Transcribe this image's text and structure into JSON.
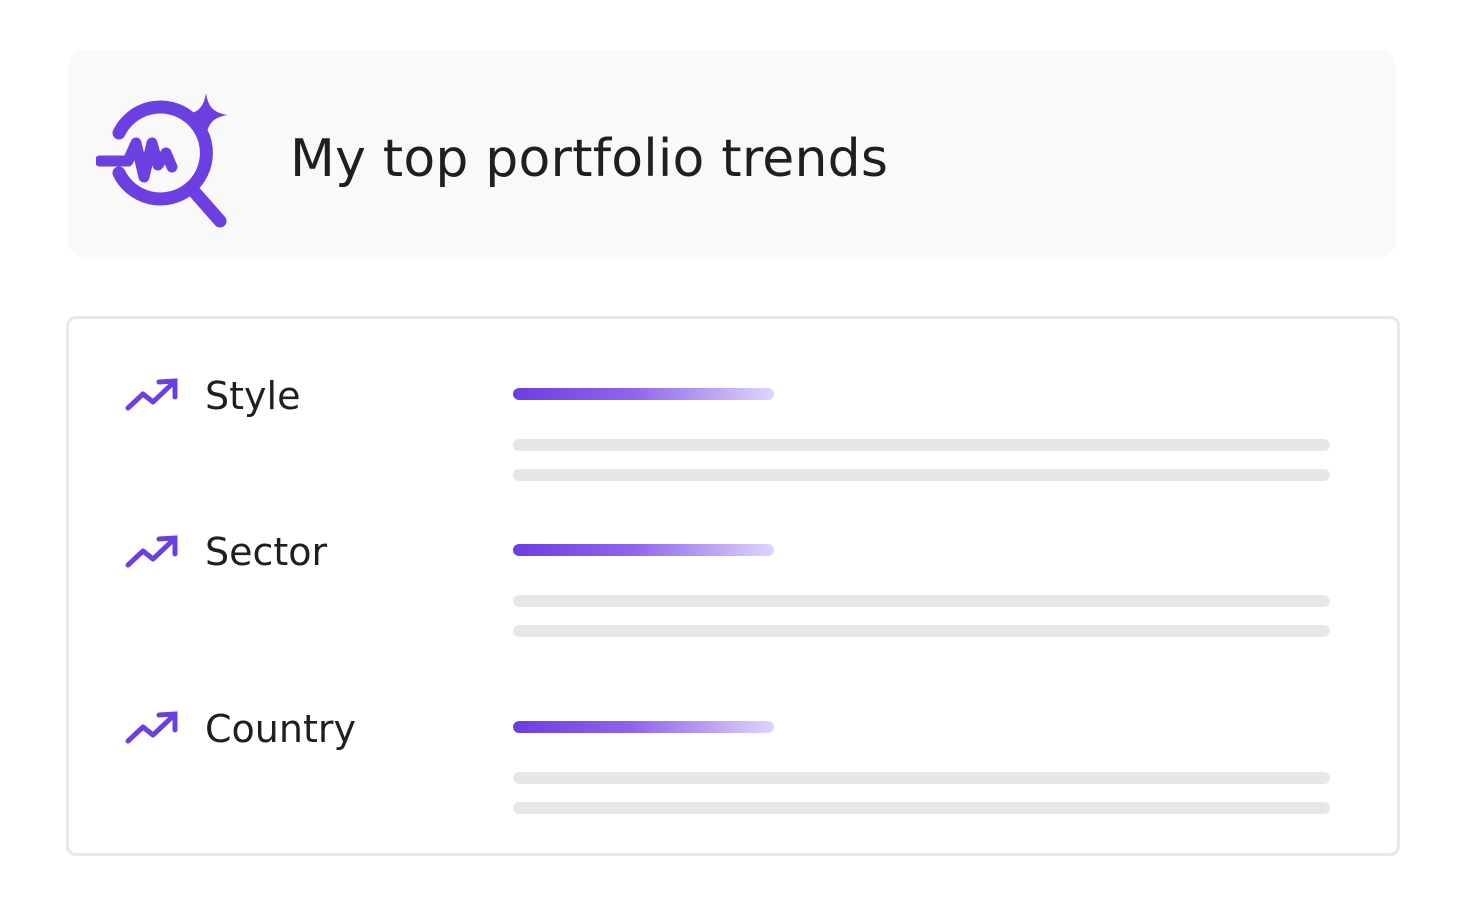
{
  "header": {
    "title": "My top portfolio trends",
    "icon": "insight-search-icon",
    "accent_color": "#6b3fe0"
  },
  "trends": [
    {
      "label": "Style",
      "icon": "trending-up-icon"
    },
    {
      "label": "Sector",
      "icon": "trending-up-icon"
    },
    {
      "label": "Country",
      "icon": "trending-up-icon"
    }
  ]
}
